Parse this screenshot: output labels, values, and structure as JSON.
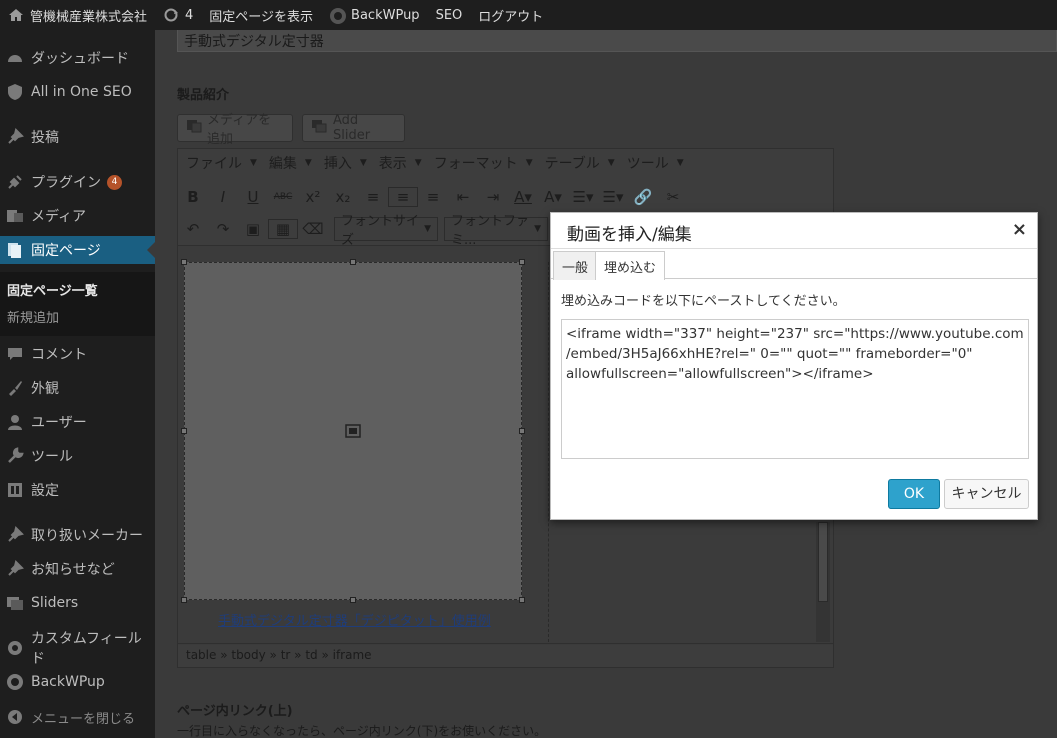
{
  "adminbar": {
    "site_name": "管機械産業株式会社",
    "updates_count": "4",
    "view_page": "固定ページを表示",
    "backwpup": "BackWPup",
    "seo": "SEO",
    "logout": "ログアウト"
  },
  "sidebar": {
    "dashboard": "ダッシュボード",
    "all_in_one_seo": "All in One SEO",
    "posts": "投稿",
    "plugins": "プラグイン",
    "plugins_badge": "4",
    "media": "メディア",
    "pages": "固定ページ",
    "pages_all": "固定ページ一覧",
    "pages_new": "新規追加",
    "comments": "コメント",
    "appearance": "外観",
    "users": "ユーザー",
    "tools": "ツール",
    "settings": "設定",
    "makers": "取り扱いメーカー",
    "notices": "お知らせなど",
    "sliders": "Sliders",
    "custom_fields": "カスタムフィールド",
    "backwpup": "BackWPup",
    "collapse": "メニューを閉じる"
  },
  "editor": {
    "page_title": "手動式デジタル定寸器",
    "section_label": "製品紹介",
    "add_media": "メディアを追加",
    "add_slider": "Add Slider",
    "menu": [
      "ファイル",
      "編集",
      "挿入",
      "表示",
      "フォーマット",
      "テーブル",
      "ツール"
    ],
    "font_size": "フォントサイズ",
    "font_family": "フォントファミ...",
    "caption": "手動式デジタル定寸器「デジピタット」使用例",
    "path": "table » tbody » tr » td » iframe",
    "below_label": "ページ内リンク(上)",
    "below_note": "一行目に入らなくなったら、ページ内リンク(下)をお使いください。"
  },
  "modal": {
    "title": "動画を挿入/編集",
    "close": "×",
    "tab_general": "一般",
    "tab_embed": "埋め込む",
    "description": "埋め込みコードを以下にペーストしてください。",
    "embed_code": "<iframe width=\"337\" height=\"237\" src=\"https://www.youtube.com\n/embed/3H5aJ66xhHE?rel=\" 0=\"\" quot=\"\" frameborder=\"0\"\nallowfullscreen=\"allowfullscreen\"></iframe>",
    "ok": "OK",
    "cancel": "キャンセル"
  },
  "colors": {
    "accent": "#2ea2cc",
    "admin_bg": "#1e1e1e",
    "current_menu": "#1a5f82"
  }
}
